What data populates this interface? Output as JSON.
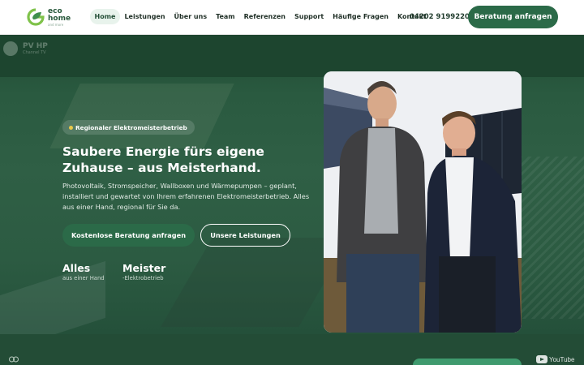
{
  "brand": {
    "name_line1": "eco",
    "name_line2": "home",
    "tagline": "and more"
  },
  "nav": {
    "items": [
      "Home",
      "Leistungen",
      "Über uns",
      "Team",
      "Referenzen",
      "Support",
      "Häufige Fragen",
      "Kontakt"
    ],
    "active": "Home"
  },
  "header": {
    "phone": "04202 9199220",
    "cta": "Beratung anfragen"
  },
  "hero": {
    "watermark_title": "PV HP",
    "watermark_subtitle": "Channel TV",
    "badge": "Regionaler Elektromeisterbetrieb",
    "headline": "Saubere Energie fürs eigene Zuhause – aus Meisterhand.",
    "description": "Photovoltaik, Stromspeicher, Wallboxen und Wärmepumpen – geplant, installiert und gewartet von Ihrem erfahrenen Elektromeisterbetrieb. Alles aus einer Hand, regional für Sie da.",
    "primary_button": "Kostenlose Beratung anfragen",
    "secondary_button": "Unsere Leistungen",
    "stats": [
      {
        "value": "Alles",
        "label": "aus einer Hand"
      },
      {
        "value": "Meister",
        "label": "-Elektrobetrieb"
      }
    ]
  },
  "footer_strip": {
    "video_label": "YouTube"
  },
  "colors": {
    "brand_green": "#2b6a48",
    "hero_bg": "#2c5b42",
    "accent_yellow": "#e9c84a",
    "nav_active_bg": "#e8f3ec"
  }
}
